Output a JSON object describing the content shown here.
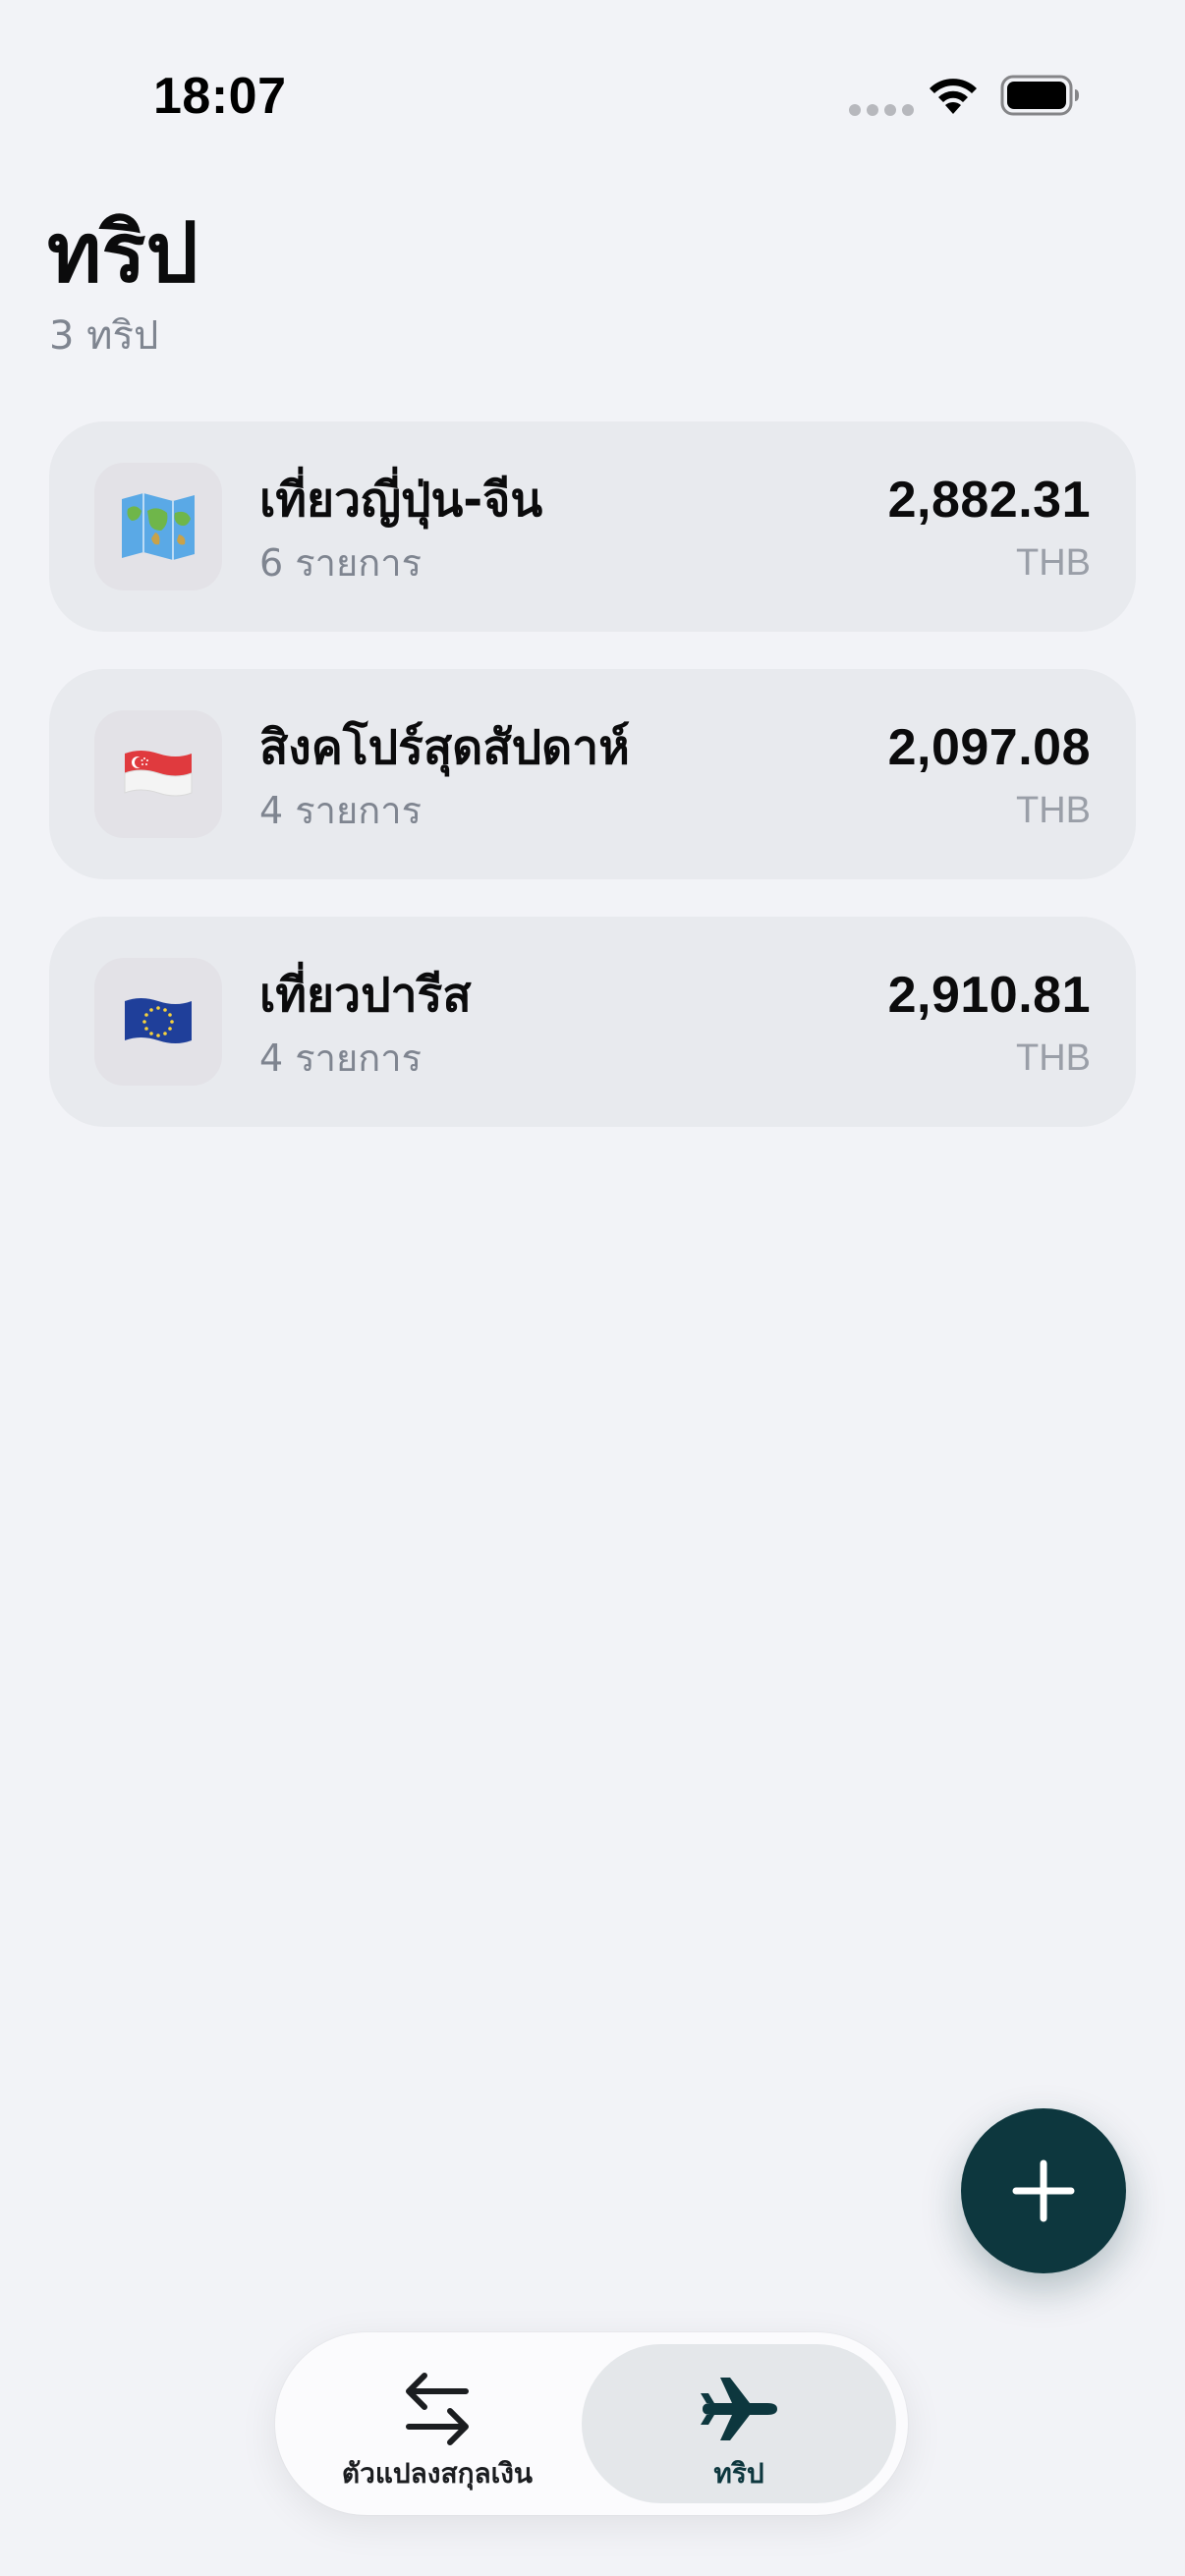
{
  "status_bar": {
    "time": "18:07"
  },
  "header": {
    "title": "ทริป",
    "subtitle": "3 ทริป"
  },
  "trips": [
    {
      "icon": "world-map-icon",
      "name": "เที่ยวญี่ปุ่น-จีน",
      "count": "6 รายการ",
      "amount": "2,882.31",
      "currency": "THB"
    },
    {
      "icon": "singapore-flag-icon",
      "name": "สิงคโปร์สุดสัปดาห์",
      "count": "4 รายการ",
      "amount": "2,097.08",
      "currency": "THB"
    },
    {
      "icon": "eu-flag-icon",
      "name": "เที่ยวปารีส",
      "count": "4 รายการ",
      "amount": "2,910.81",
      "currency": "THB"
    }
  ],
  "fab": {
    "icon": "plus-icon"
  },
  "tab_bar": {
    "tabs": [
      {
        "label": "ตัวแปลงสกุลเงิน",
        "icon": "swap-arrows-icon",
        "selected": false
      },
      {
        "label": "ทริป",
        "icon": "airplane-icon",
        "selected": true
      }
    ]
  },
  "colors": {
    "background": "#f2f3f7",
    "card": "#e8eaee",
    "accent": "#0d373e",
    "secondary_text": "#7f8590"
  }
}
